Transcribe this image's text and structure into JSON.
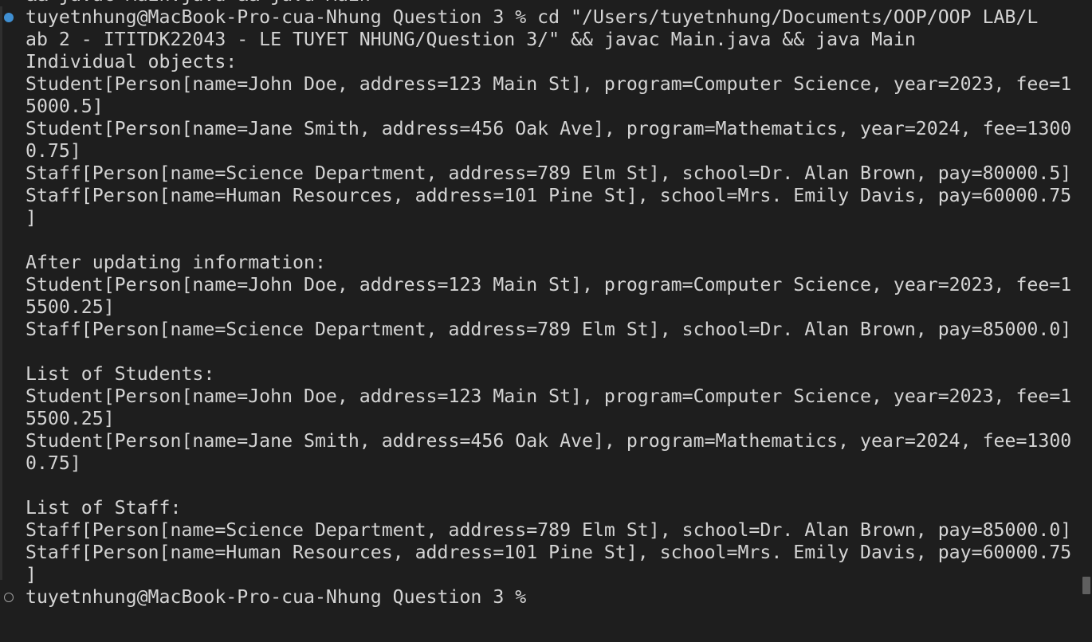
{
  "terminal": {
    "lines": [
      {
        "text": "&& javac Main.java && java Main",
        "marker": ""
      },
      {
        "text": "tuyetnhung@MacBook-Pro-cua-Nhung Question 3 % cd \"/Users/tuyetnhung/Documents/OOP/OOP LAB/L",
        "marker": "filled"
      },
      {
        "text": "ab 2 - ITITDK22043 - LE TUYET NHUNG/Question 3/\" && javac Main.java && java Main",
        "marker": ""
      },
      {
        "text": "Individual objects:",
        "marker": ""
      },
      {
        "text": "Student[Person[name=John Doe, address=123 Main St], program=Computer Science, year=2023, fee=1",
        "marker": ""
      },
      {
        "text": "5000.5]",
        "marker": ""
      },
      {
        "text": "Student[Person[name=Jane Smith, address=456 Oak Ave], program=Mathematics, year=2024, fee=1300",
        "marker": ""
      },
      {
        "text": "0.75]",
        "marker": ""
      },
      {
        "text": "Staff[Person[name=Science Department, address=789 Elm St], school=Dr. Alan Brown, pay=80000.5]",
        "marker": ""
      },
      {
        "text": "Staff[Person[name=Human Resources, address=101 Pine St], school=Mrs. Emily Davis, pay=60000.75",
        "marker": ""
      },
      {
        "text": "]",
        "marker": ""
      },
      {
        "text": "",
        "marker": ""
      },
      {
        "text": "After updating information:",
        "marker": ""
      },
      {
        "text": "Student[Person[name=John Doe, address=123 Main St], program=Computer Science, year=2023, fee=1",
        "marker": ""
      },
      {
        "text": "5500.25]",
        "marker": ""
      },
      {
        "text": "Staff[Person[name=Science Department, address=789 Elm St], school=Dr. Alan Brown, pay=85000.0]",
        "marker": ""
      },
      {
        "text": "",
        "marker": ""
      },
      {
        "text": "List of Students:",
        "marker": ""
      },
      {
        "text": "Student[Person[name=John Doe, address=123 Main St], program=Computer Science, year=2023, fee=1",
        "marker": ""
      },
      {
        "text": "5500.25]",
        "marker": ""
      },
      {
        "text": "Student[Person[name=Jane Smith, address=456 Oak Ave], program=Mathematics, year=2024, fee=1300",
        "marker": ""
      },
      {
        "text": "0.75]",
        "marker": ""
      },
      {
        "text": "",
        "marker": ""
      },
      {
        "text": "List of Staff:",
        "marker": ""
      },
      {
        "text": "Staff[Person[name=Science Department, address=789 Elm St], school=Dr. Alan Brown, pay=85000.0]",
        "marker": ""
      },
      {
        "text": "Staff[Person[name=Human Resources, address=101 Pine St], school=Mrs. Emily Davis, pay=60000.75",
        "marker": ""
      },
      {
        "text": "]",
        "marker": ""
      },
      {
        "text": "tuyetnhung@MacBook-Pro-cua-Nhung Question 3 % ",
        "marker": "hollow"
      }
    ]
  },
  "colors": {
    "background": "#1e1e1e",
    "text": "#d4d4d4",
    "command_marker": "#3f8fd2",
    "prompt_marker": "#a0a0a0"
  }
}
